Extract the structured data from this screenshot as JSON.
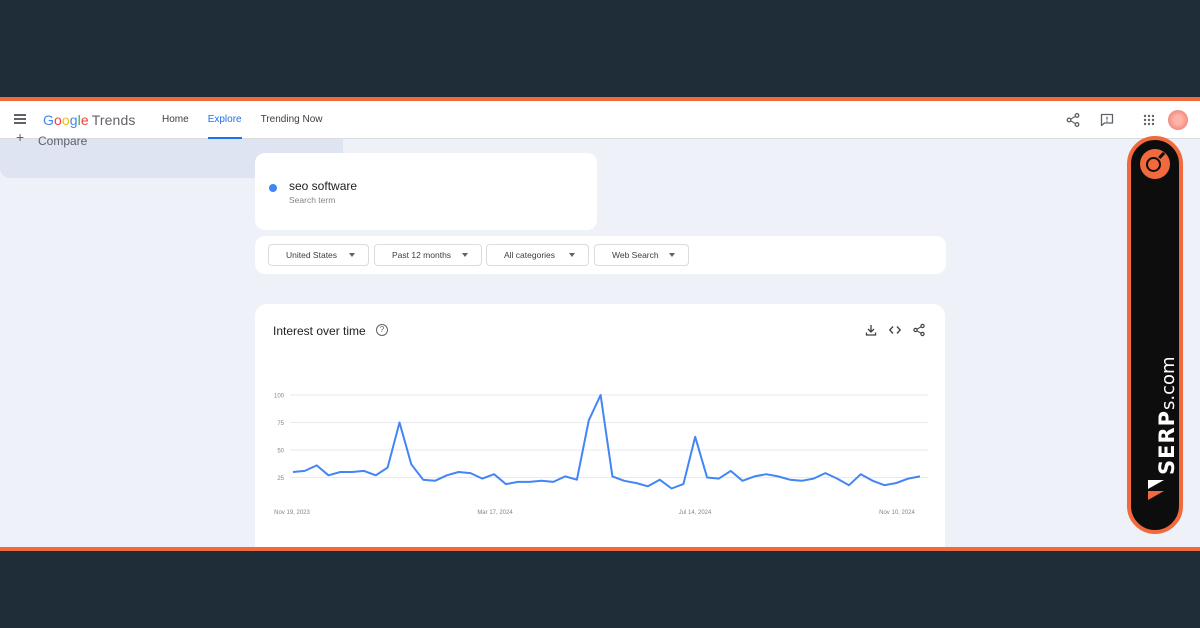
{
  "header": {
    "logo": [
      "G",
      "o",
      "o",
      "g",
      "l",
      "e"
    ],
    "product": "Trends",
    "nav": [
      {
        "label": "Home",
        "active": false
      },
      {
        "label": "Explore",
        "active": true
      },
      {
        "label": "Trending Now",
        "active": false
      }
    ],
    "icons": [
      "share-icon",
      "feedback-icon",
      "apps-grid-icon",
      "avatar"
    ]
  },
  "search": {
    "term": "seo software",
    "term_type": "Search term",
    "term_color": "#4285f4",
    "compare_label": "Compare"
  },
  "filters": {
    "region": "United States",
    "time": "Past 12 months",
    "category": "All categories",
    "property": "Web Search"
  },
  "interest_card": {
    "title": "Interest over time",
    "icons": [
      "download-icon",
      "embed-icon",
      "share-icon"
    ]
  },
  "chart_data": {
    "type": "line",
    "title": "Interest over time",
    "series": [
      {
        "name": "seo software",
        "color": "#4285f4"
      }
    ],
    "y_ticks": [
      "100",
      "75",
      "50",
      "25"
    ],
    "x_tick_labels": [
      "Nov 19, 2023",
      "Mar 17, 2024",
      "Jul 14, 2024",
      "Nov 10, 2024"
    ],
    "ylim": [
      0,
      100
    ],
    "grid": true,
    "values": [
      30,
      31,
      36,
      27,
      30,
      30,
      31,
      27,
      34,
      75,
      37,
      23,
      22,
      27,
      30,
      29,
      24,
      28,
      19,
      21,
      21,
      22,
      21,
      26,
      23,
      77,
      100,
      26,
      22,
      20,
      17,
      23,
      15,
      19,
      62,
      25,
      24,
      31,
      22,
      26,
      28,
      26,
      23,
      22,
      24,
      29,
      24,
      18,
      28,
      22,
      18,
      20,
      24,
      26
    ]
  },
  "brand": {
    "name": "SERP",
    "suffix": "s.com",
    "accent": "#f06a3d"
  }
}
